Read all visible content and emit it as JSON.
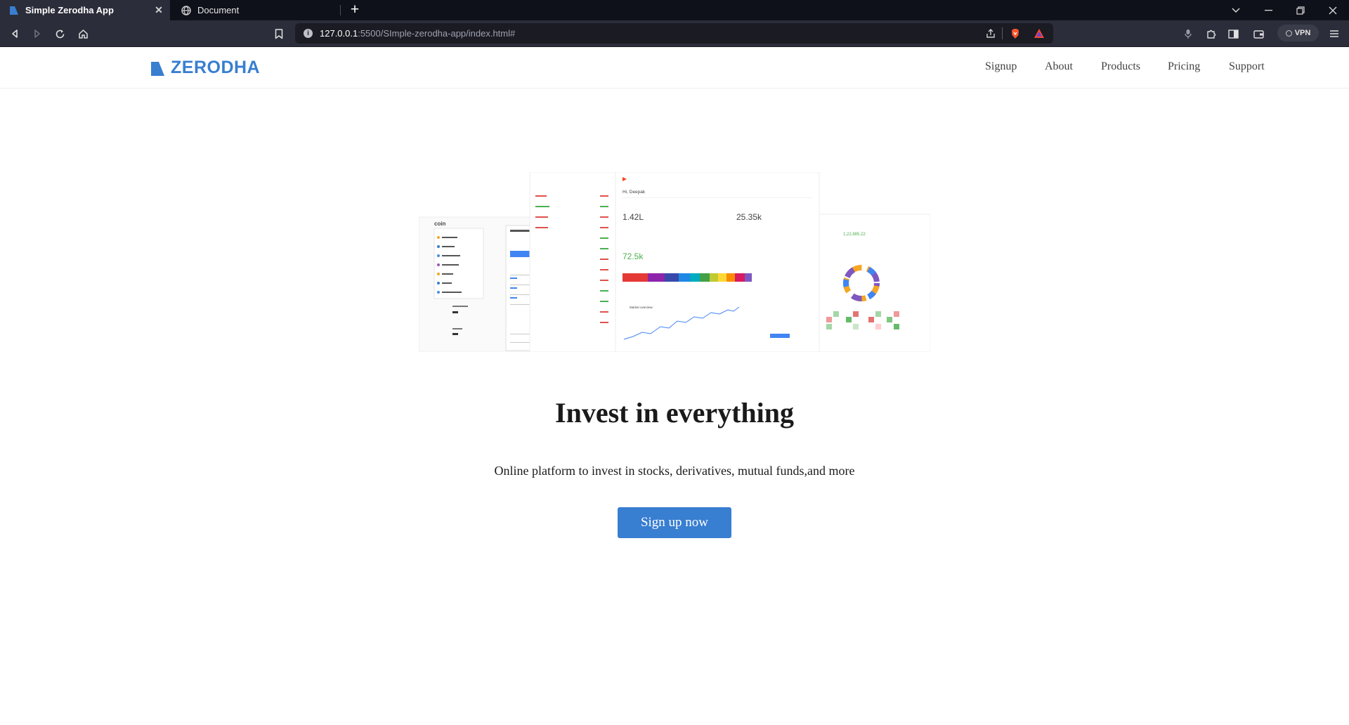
{
  "browser": {
    "tabs": [
      {
        "title": "Simple Zerodha App",
        "active": true
      },
      {
        "title": "Document",
        "active": false
      }
    ],
    "url": {
      "host": "127.0.0.1",
      "path": ":5500/SImple-zerodha-app/index.html#"
    },
    "vpn_label": "VPN"
  },
  "navbar": {
    "logo_text": "ZERODHA",
    "links": [
      "Signup",
      "About",
      "Products",
      "Pricing",
      "Support"
    ]
  },
  "hero": {
    "title": "Invest in everything",
    "subtitle": "Online platform to invest in stocks, derivatives, mutual funds,and more",
    "cta_label": "Sign up now"
  },
  "dashboard_image": {
    "coin_label": "coin",
    "kite_greeting": "Hi, Deepak",
    "equity_value": "1.42L",
    "commodity_value": "25.35k",
    "holdings_value": "72.5k",
    "market_overview_label": "Market overview",
    "unrealised_value": "1,22,885.22"
  },
  "colors": {
    "brand": "#387ed1",
    "tabbar": "#0f111a",
    "toolbar": "#2b2d3a"
  }
}
